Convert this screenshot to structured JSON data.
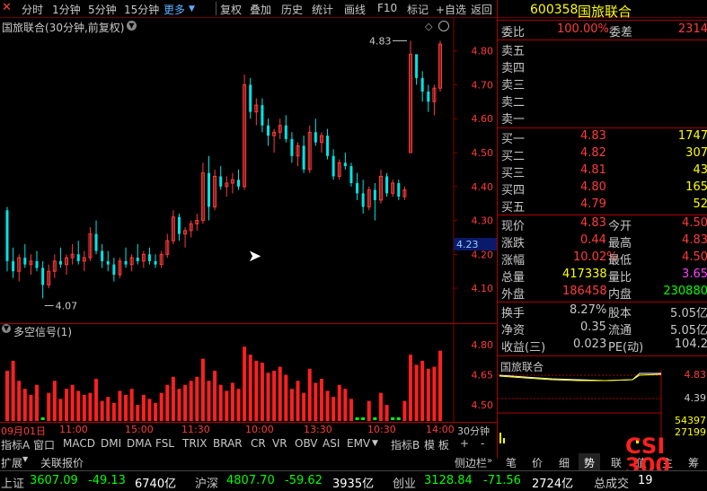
{
  "toolbar": {
    "left_items": [
      "分时",
      "1分钟",
      "5分钟",
      "15分钟",
      "更多"
    ],
    "right_items": [
      "复权",
      "叠加",
      "历史",
      "统计",
      "画线",
      "F10",
      "标记",
      "+自选",
      "返回"
    ]
  },
  "chart_title": "国旅联合(30分钟,前复权)",
  "indicator_title": "多空信号(1)",
  "quote": {
    "code": "600358",
    "name": "国旅联合",
    "weibi_label": "委比",
    "weibi_value": "100.00%",
    "weicha_label": "委差",
    "weicha_value": "2314",
    "sell_labels": [
      "卖五",
      "卖四",
      "卖三",
      "卖二",
      "卖一"
    ],
    "buy": [
      {
        "label": "买一",
        "price": "4.83",
        "vol": "1747"
      },
      {
        "label": "买二",
        "price": "4.82",
        "vol": "307"
      },
      {
        "label": "买三",
        "price": "4.81",
        "vol": "43"
      },
      {
        "label": "买四",
        "price": "4.80",
        "vol": "165"
      },
      {
        "label": "买五",
        "price": "4.79",
        "vol": "52"
      }
    ],
    "stats": [
      {
        "l1": "现价",
        "v1": "4.83",
        "l2": "今开",
        "v2": "4.50"
      },
      {
        "l1": "涨跌",
        "v1": "0.44",
        "l2": "最高",
        "v2": "4.83"
      },
      {
        "l1": "涨幅",
        "v1": "10.02%",
        "l2": "最低",
        "v2": "4.50"
      },
      {
        "l1": "总量",
        "v1": "417338",
        "l2": "量比",
        "v2": "3.65"
      },
      {
        "l1": "外盘",
        "v1": "186458",
        "l2": "内盘",
        "v2": "230880"
      }
    ],
    "stats2": [
      {
        "l1": "换手",
        "v1": "8.27%",
        "l2": "股本",
        "v2": "5.05亿"
      },
      {
        "l1": "净资",
        "v1": "0.35",
        "l2": "流通",
        "v2": "5.05亿"
      },
      {
        "l1": "收益(三)",
        "v1": "0.023",
        "l2": "PE(动)",
        "v2": "104.2"
      }
    ],
    "mini_title": "国旅联合",
    "mini_price_hi": "4.83",
    "mini_price_mid": "4.39",
    "mini_vol_hi": "54397",
    "mini_vol_mid": "27199"
  },
  "axis": {
    "price_ticks": [
      "4.80",
      "4.70",
      "4.60",
      "4.50",
      "4.40",
      "4.30",
      "4.20",
      "4.10"
    ],
    "current_price_tag": "4.23",
    "indicator_ticks": [
      "4.80",
      "4.65",
      "4.50"
    ],
    "time_ticks": [
      "09月01日",
      "11:00",
      "15:00",
      "11:30",
      "10:00",
      "13:30",
      "10:30",
      "14:00"
    ],
    "period_label": "30分钟",
    "hi_mark": "4.83",
    "lo_mark": "4.07"
  },
  "chart_data": {
    "type": "candlestick",
    "title": "国旅联合(30分钟,前复权)",
    "ylim": [
      4.05,
      4.86
    ],
    "high_marker": 4.83,
    "low_marker": 4.07,
    "candles": [
      [
        4.33,
        4.34,
        4.15,
        4.18
      ],
      [
        4.18,
        4.22,
        4.13,
        4.15
      ],
      [
        4.15,
        4.2,
        4.12,
        4.19
      ],
      [
        4.19,
        4.23,
        4.16,
        4.17
      ],
      [
        4.17,
        4.2,
        4.14,
        4.18
      ],
      [
        4.18,
        4.21,
        4.15,
        4.16
      ],
      [
        4.16,
        4.18,
        4.07,
        4.11
      ],
      [
        4.11,
        4.17,
        4.1,
        4.15
      ],
      [
        4.15,
        4.2,
        4.13,
        4.18
      ],
      [
        4.18,
        4.22,
        4.16,
        4.17
      ],
      [
        4.17,
        4.2,
        4.14,
        4.19
      ],
      [
        4.19,
        4.23,
        4.17,
        4.2
      ],
      [
        4.2,
        4.24,
        4.17,
        4.18
      ],
      [
        4.18,
        4.21,
        4.15,
        4.19
      ],
      [
        4.19,
        4.28,
        4.18,
        4.26
      ],
      [
        4.26,
        4.3,
        4.2,
        4.21
      ],
      [
        4.21,
        4.23,
        4.16,
        4.18
      ],
      [
        4.18,
        4.21,
        4.15,
        4.17
      ],
      [
        4.17,
        4.19,
        4.12,
        4.14
      ],
      [
        4.14,
        4.19,
        4.13,
        4.18
      ],
      [
        4.18,
        4.22,
        4.16,
        4.17
      ],
      [
        4.17,
        4.2,
        4.15,
        4.19
      ],
      [
        4.19,
        4.23,
        4.17,
        4.18
      ],
      [
        4.18,
        4.21,
        4.16,
        4.2
      ],
      [
        4.2,
        4.22,
        4.17,
        4.18
      ],
      [
        4.18,
        4.2,
        4.16,
        4.17
      ],
      [
        4.17,
        4.21,
        4.16,
        4.2
      ],
      [
        4.2,
        4.26,
        4.19,
        4.24
      ],
      [
        4.24,
        4.33,
        4.23,
        4.31
      ],
      [
        4.31,
        4.32,
        4.24,
        4.26
      ],
      [
        4.26,
        4.28,
        4.22,
        4.27
      ],
      [
        4.27,
        4.3,
        4.25,
        4.29
      ],
      [
        4.29,
        4.32,
        4.27,
        4.3
      ],
      [
        4.3,
        4.47,
        4.29,
        4.44
      ],
      [
        4.44,
        4.49,
        4.3,
        4.34
      ],
      [
        4.34,
        4.45,
        4.33,
        4.43
      ],
      [
        4.43,
        4.46,
        4.39,
        4.4
      ],
      [
        4.4,
        4.43,
        4.37,
        4.41
      ],
      [
        4.41,
        4.44,
        4.38,
        4.42
      ],
      [
        4.42,
        4.45,
        4.39,
        4.4
      ],
      [
        4.4,
        4.73,
        4.39,
        4.7
      ],
      [
        4.7,
        4.72,
        4.6,
        4.62
      ],
      [
        4.62,
        4.66,
        4.58,
        4.64
      ],
      [
        4.64,
        4.66,
        4.56,
        4.58
      ],
      [
        4.58,
        4.6,
        4.52,
        4.55
      ],
      [
        4.55,
        4.57,
        4.5,
        4.56
      ],
      [
        4.56,
        4.6,
        4.54,
        4.58
      ],
      [
        4.58,
        4.61,
        4.53,
        4.54
      ],
      [
        4.54,
        4.56,
        4.47,
        4.49
      ],
      [
        4.49,
        4.53,
        4.46,
        4.52
      ],
      [
        4.52,
        4.55,
        4.44,
        4.45
      ],
      [
        4.45,
        4.58,
        4.44,
        4.56
      ],
      [
        4.56,
        4.6,
        4.52,
        4.53
      ],
      [
        4.53,
        4.56,
        4.5,
        4.55
      ],
      [
        4.55,
        4.57,
        4.48,
        4.49
      ],
      [
        4.49,
        4.51,
        4.42,
        4.43
      ],
      [
        4.43,
        4.48,
        4.42,
        4.47
      ],
      [
        4.47,
        4.5,
        4.45,
        4.46
      ],
      [
        4.46,
        4.47,
        4.4,
        4.41
      ],
      [
        4.41,
        4.44,
        4.36,
        4.38
      ],
      [
        4.38,
        4.42,
        4.32,
        4.34
      ],
      [
        4.34,
        4.4,
        4.33,
        4.39
      ],
      [
        4.39,
        4.41,
        4.3,
        4.36
      ],
      [
        4.36,
        4.45,
        4.35,
        4.43
      ],
      [
        4.43,
        4.44,
        4.37,
        4.38
      ],
      [
        4.38,
        4.42,
        4.37,
        4.41
      ],
      [
        4.41,
        4.42,
        4.36,
        4.37
      ],
      [
        4.37,
        4.4,
        4.36,
        4.39
      ],
      [
        4.5,
        4.83,
        4.5,
        4.79
      ],
      [
        4.79,
        4.76,
        4.7,
        4.72
      ],
      [
        4.72,
        4.74,
        4.65,
        4.68
      ],
      [
        4.68,
        4.7,
        4.62,
        4.65
      ],
      [
        4.65,
        4.7,
        4.61,
        4.69
      ],
      [
        4.69,
        4.83,
        4.68,
        4.82
      ]
    ],
    "indicator_values": [
      4.67,
      4.72,
      4.62,
      4.58,
      4.55,
      4.6,
      4.48,
      4.56,
      4.62,
      4.53,
      4.58,
      4.6,
      4.57,
      4.55,
      4.56,
      4.63,
      4.52,
      4.54,
      4.51,
      4.57,
      4.55,
      4.58,
      4.5,
      4.55,
      4.53,
      4.51,
      4.56,
      4.6,
      4.64,
      4.58,
      4.6,
      4.62,
      4.64,
      4.73,
      4.62,
      4.67,
      4.6,
      4.57,
      4.61,
      4.58,
      4.79,
      4.75,
      4.72,
      4.71,
      4.66,
      4.67,
      4.69,
      4.65,
      4.58,
      4.62,
      4.56,
      4.68,
      4.61,
      4.63,
      4.57,
      4.54,
      4.6,
      4.58,
      4.53,
      4.49,
      4.47,
      4.52,
      4.48,
      4.56,
      4.5,
      4.49,
      4.48,
      4.52,
      4.75,
      4.7,
      4.72,
      4.68,
      4.69,
      4.77
    ]
  },
  "tabs": [
    "指标A",
    "窗口",
    "MACD",
    "DMI",
    "DMA",
    "FSL",
    "TRIX",
    "BRAR",
    "CR",
    "VR",
    "OBV",
    "ASI",
    "EMV",
    "指标B",
    "模 板"
  ],
  "subbar": {
    "left": [
      "扩展",
      "关联报价"
    ],
    "right": [
      "侧边栏",
      "笔",
      "价",
      "细",
      "势",
      "联",
      "值",
      "主",
      "筹"
    ]
  },
  "index_bar": {
    "items": [
      {
        "name": "上证",
        "value": "3607.09",
        "change": "-49.13",
        "amount": "6740亿"
      },
      {
        "name": "沪深",
        "value": "4807.70",
        "change": "-59.62",
        "amount": "3935亿"
      },
      {
        "name": "创业",
        "value": "3128.84",
        "change": "-71.56",
        "amount": "2724亿"
      }
    ],
    "total_label": "总成交",
    "total_value": "19"
  },
  "watermark": [
    "CSI",
    "300"
  ],
  "colors": {
    "up": "#ff3b3b",
    "down": "#00e5e5",
    "bg": "#000000",
    "grid": "#8a0000",
    "yellow": "#ffff00"
  }
}
